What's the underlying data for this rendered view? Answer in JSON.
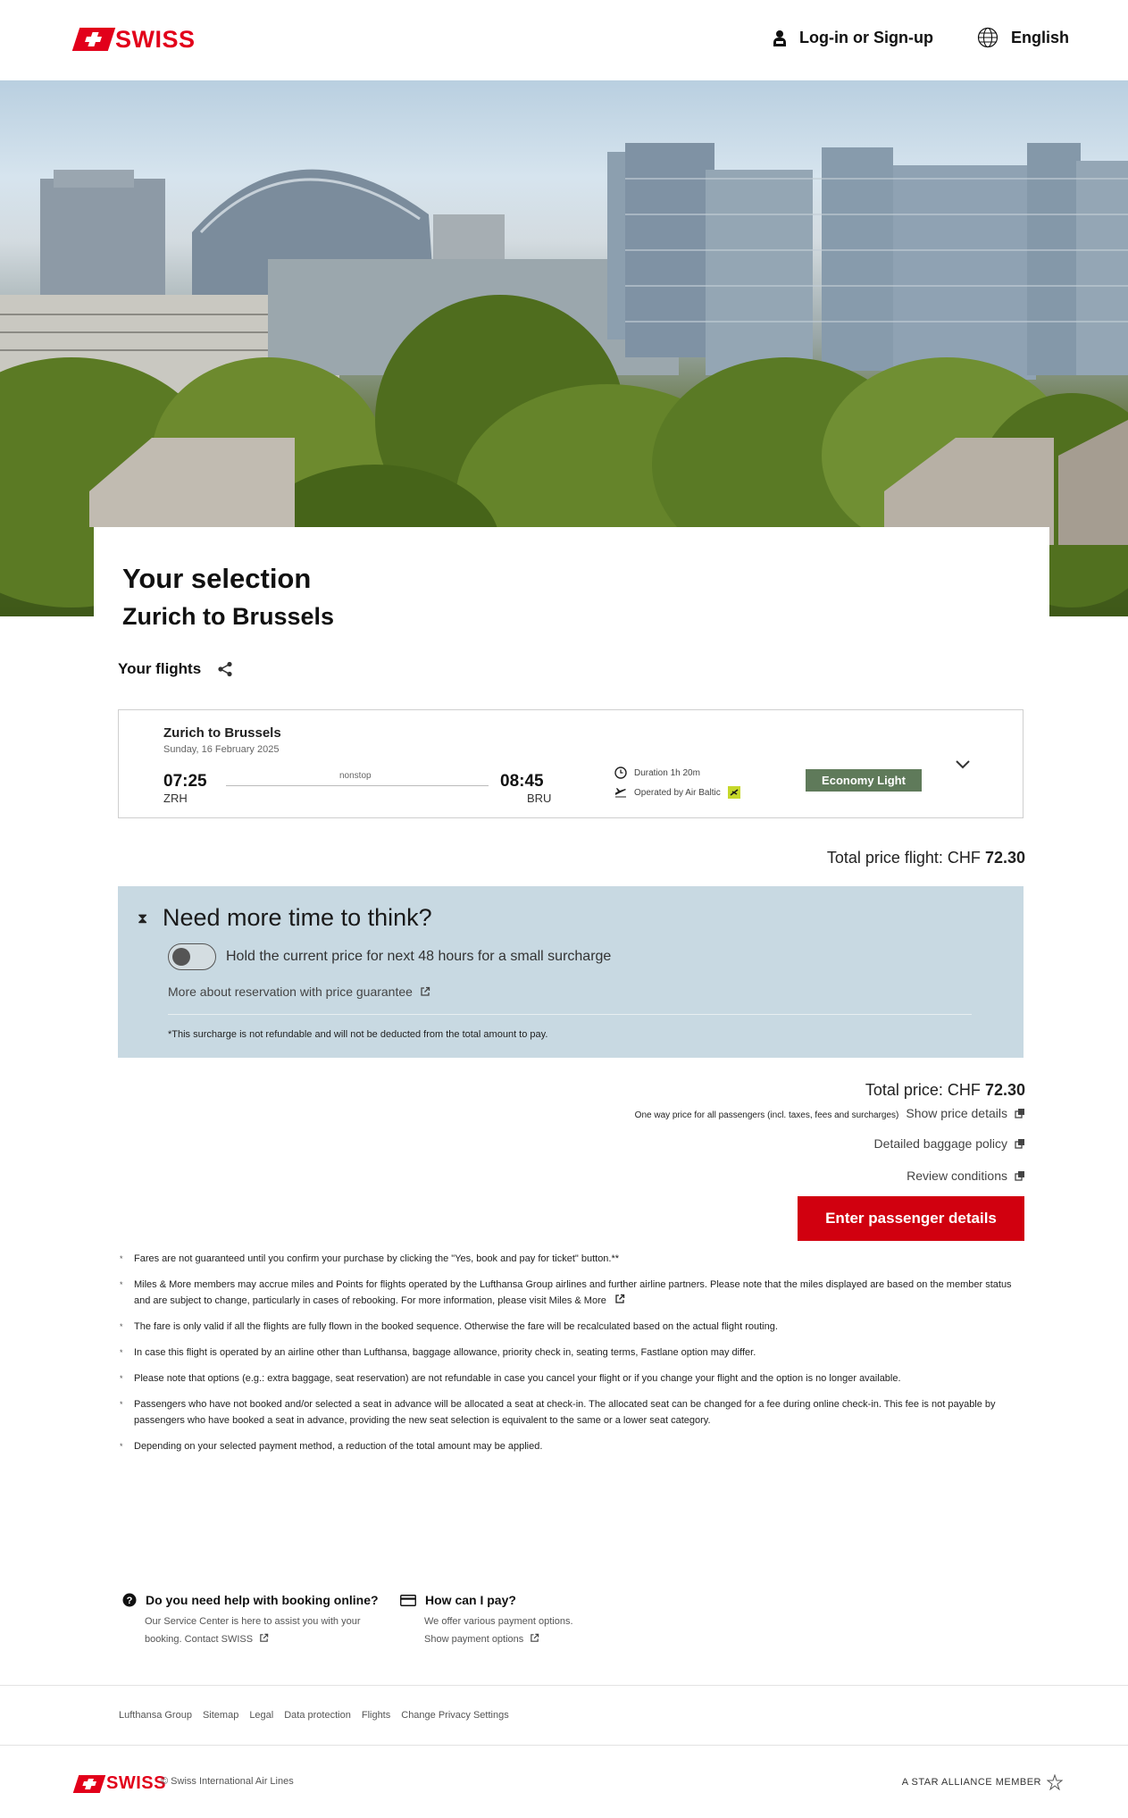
{
  "header": {
    "brand": "SWISS",
    "login_label": "Log-in or Sign-up",
    "language_label": "English"
  },
  "selection": {
    "title": "Your selection",
    "route": "Zurich to Brussels",
    "your_flights_label": "Your flights"
  },
  "flight": {
    "route": "Zurich to Brussels",
    "date": "Sunday, 16 February 2025",
    "dep_time": "07:25",
    "dep_code": "ZRH",
    "arr_time": "08:45",
    "arr_code": "BRU",
    "stops": "nonstop",
    "duration": "Duration  1h 20m",
    "operated_by": "Operated by  Air Baltic",
    "fare": "Economy Light"
  },
  "price_flight": {
    "label": "Total price flight: CHF",
    "amount": "72.30"
  },
  "hold": {
    "title": "Need more time to think?",
    "toggle_label": "Hold the current price for next 48 hours for a small surcharge",
    "link": "More about reservation with price guarantee",
    "note": "*This surcharge is not refundable and will not be deducted from the total amount to pay."
  },
  "total": {
    "label": "Total price: CHF",
    "amount": "72.30",
    "oneway_note": "One way price for all passengers (incl. taxes, fees and surcharges)",
    "price_details": "Show price details",
    "baggage": "Detailed baggage policy",
    "conditions": "Review conditions"
  },
  "cta": {
    "label": "Enter passenger details"
  },
  "notes": [
    "Fares are not guaranteed until you confirm your purchase by clicking the \"Yes, book and pay for ticket\" button.**",
    "Miles & More members may accrue miles and Points for flights operated by the Lufthansa Group airlines and further airline partners. Please note that the miles displayed are based on the member status and are subject to change, particularly in cases of rebooking. For more information, please visit Miles & More",
    "The fare is only valid if all the flights are fully flown in the booked sequence. Otherwise the fare will be recalculated based on the actual flight routing.",
    "In case this flight is operated by an airline other than Lufthansa, baggage allowance, priority check in, seating terms, Fastlane option may differ.",
    "Please note that options (e.g.: extra baggage, seat reservation) are not refundable in case you cancel your flight or if you change your flight and the option is no longer available.",
    "Passengers who have not booked and/or selected a seat in advance will be allocated a seat at check-in. The allocated seat can be changed for a fee during online check-in. This fee is not payable by passengers who have booked a seat in advance, providing the new seat selection is equivalent to the same or a lower seat category.",
    "Depending on your selected payment method, a reduction of the total amount may be applied."
  ],
  "help": {
    "booking_title": "Do you need help with booking online?",
    "booking_text": "Our Service Center is here to assist you with your booking.",
    "booking_link": "Contact SWISS",
    "pay_title": "How can I pay?",
    "pay_text": "We offer various payment options.",
    "pay_link": "Show payment options"
  },
  "footer": {
    "links": [
      "Lufthansa Group",
      "Sitemap",
      "Legal",
      "Data protection",
      "Flights",
      "Change Privacy Settings"
    ],
    "brand": "SWISS",
    "copyright": "© Swiss International Air Lines",
    "alliance": "A STAR ALLIANCE MEMBER"
  },
  "colors": {
    "brand_red": "#e2001a",
    "cta_red": "#d1000f",
    "hold_bg": "#c8d9e2",
    "fare_badge": "#5f7a5a"
  }
}
